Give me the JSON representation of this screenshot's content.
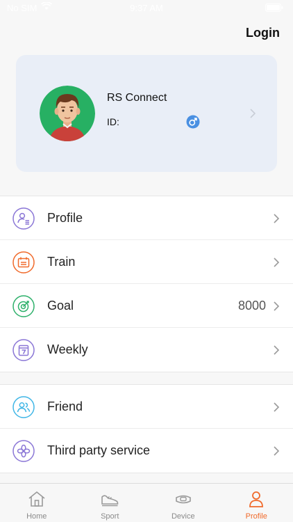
{
  "status_bar": {
    "carrier": "No SIM",
    "time": "9:37 AM"
  },
  "header": {
    "login_label": "Login"
  },
  "profile": {
    "name": "RS Connect",
    "id_label": "ID:"
  },
  "menu": {
    "group1": [
      {
        "label": "Profile",
        "value": ""
      },
      {
        "label": "Train",
        "value": ""
      },
      {
        "label": "Goal",
        "value": "8000"
      },
      {
        "label": "Weekly",
        "value": ""
      }
    ],
    "group2": [
      {
        "label": "Friend",
        "value": ""
      },
      {
        "label": "Third party service",
        "value": ""
      }
    ]
  },
  "tabs": [
    {
      "label": "Home"
    },
    {
      "label": "Sport"
    },
    {
      "label": "Device"
    },
    {
      "label": "Profile"
    }
  ],
  "colors": {
    "accent": "#f06a2b",
    "profile_icon": "#8a76d6",
    "train_icon": "#f06a2b",
    "goal_icon": "#2db06a",
    "weekly_icon": "#8a76d6",
    "friend_icon": "#3fb6e6",
    "third_party_icon": "#8a76d6",
    "gender_icon": "#4a90e2"
  },
  "icons": {
    "profile": "user-list-icon",
    "train": "calendar-icon",
    "goal": "target-icon",
    "weekly": "weekly-calendar-icon",
    "friend": "friends-icon",
    "third_party": "clover-icon"
  }
}
